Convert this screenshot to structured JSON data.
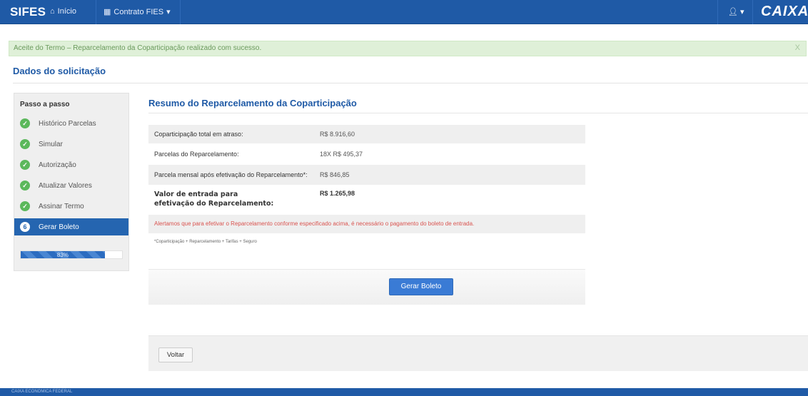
{
  "navbar": {
    "brand": "SIFES",
    "home_label": "Início",
    "contract_label": "Contrato FIES",
    "logo": "CAIXA",
    "user_icon": "user-icon"
  },
  "alert": {
    "message": "Aceite do Termo – Reparcelamento da Coparticipação realizado com sucesso.",
    "close": "X"
  },
  "page": {
    "title": "Dados do solicitação"
  },
  "sidebar": {
    "header": "Passo a passo",
    "steps": [
      {
        "label": "Histórico Parcelas",
        "mark": "✓"
      },
      {
        "label": "Simular",
        "mark": "✓"
      },
      {
        "label": "Autorização",
        "mark": "✓"
      },
      {
        "label": "Atualizar Valores",
        "mark": "✓"
      },
      {
        "label": "Assinar Termo",
        "mark": "✓"
      },
      {
        "label": "Gerar Boleto",
        "mark": "6"
      }
    ],
    "progress_text": "83%",
    "progress_value": 0.83
  },
  "main": {
    "section_title": "Resumo do Reparcelamento da Coparticipação",
    "rows": [
      {
        "label": "Coparticipação total em atraso:",
        "value": "R$ 8.916,60"
      },
      {
        "label": "Parcelas do Reparcelamento:",
        "value": "18X R$ 495,37"
      },
      {
        "label": "Parcela mensal após efetivação do Reparcelamento*:",
        "value": "R$ 846,85"
      },
      {
        "label": "Valor de entrada para efetivação do Reparcelamento:",
        "value": "R$ 1.265,98"
      }
    ],
    "warning": "Alertamos que para efetivar o Reparcelamento conforme especificado acima, é necessário o pagamento do boleto de entrada.",
    "footnote": "*Coparticipação + Reparcelamento + Tarifas + Seguro",
    "generate_button": "Gerar Boleto",
    "back_button": "Voltar"
  },
  "footer": {
    "text": "CAIXA ECONOMICA FEDERAL"
  },
  "colors": {
    "primary": "#1f5aa6",
    "success": "#5cb85c",
    "danger": "#d9534f"
  }
}
